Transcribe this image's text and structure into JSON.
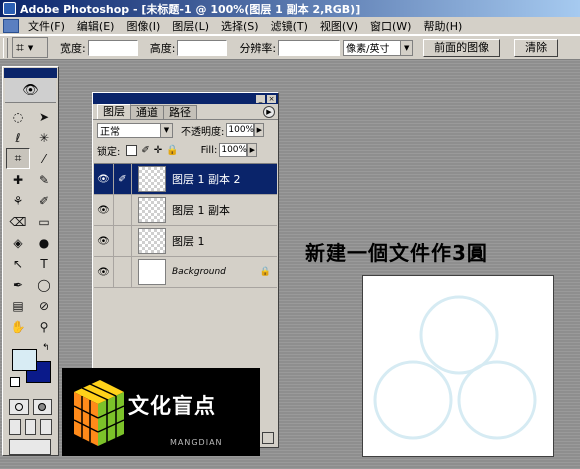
{
  "titlebar": {
    "title": "Adobe Photoshop - [未标题-1 @ 100%(图层 1 副本 2,RGB)]"
  },
  "menubar": {
    "items": [
      "文件(F)",
      "编辑(E)",
      "图像(I)",
      "图层(L)",
      "选择(S)",
      "滤镜(T)",
      "视图(V)",
      "窗口(W)",
      "帮助(H)"
    ]
  },
  "options": {
    "width_label": "宽度:",
    "width_value": "",
    "height_label": "高度:",
    "height_value": "",
    "resolution_label": "分辨率:",
    "resolution_value": "",
    "resolution_unit": "像素/英寸",
    "front_image_button": "前面的图像",
    "clear_button": "清除"
  },
  "toolbox": {
    "tools": [
      {
        "glyph": "◌",
        "name": "marquee-tool-icon"
      },
      {
        "glyph": "➤",
        "name": "move-tool-icon"
      },
      {
        "glyph": "ℓ",
        "name": "lasso-tool-icon"
      },
      {
        "glyph": "✳",
        "name": "magic-wand-tool-icon"
      },
      {
        "glyph": "⌗",
        "name": "crop-tool-icon"
      },
      {
        "glyph": "⁄",
        "name": "slice-tool-icon"
      },
      {
        "glyph": "✚",
        "name": "healing-brush-tool-icon"
      },
      {
        "glyph": "✎",
        "name": "brush-tool-icon"
      },
      {
        "glyph": "⚘",
        "name": "clone-stamp-tool-icon"
      },
      {
        "glyph": "✐",
        "name": "history-brush-tool-icon"
      },
      {
        "glyph": "⌫",
        "name": "eraser-tool-icon"
      },
      {
        "glyph": "▭",
        "name": "gradient-tool-icon"
      },
      {
        "glyph": "◈",
        "name": "blur-tool-icon"
      },
      {
        "glyph": "●",
        "name": "dodge-tool-icon"
      },
      {
        "glyph": "↖",
        "name": "path-selection-tool-icon"
      },
      {
        "glyph": "T",
        "name": "type-tool-icon"
      },
      {
        "glyph": "✒",
        "name": "pen-tool-icon"
      },
      {
        "glyph": "◯",
        "name": "shape-tool-icon"
      },
      {
        "glyph": "▤",
        "name": "notes-tool-icon"
      },
      {
        "glyph": "⊘",
        "name": "eyedropper-tool-icon"
      },
      {
        "glyph": "✋",
        "name": "hand-tool-icon"
      },
      {
        "glyph": "⚲",
        "name": "zoom-tool-icon"
      }
    ],
    "foreground_color": "#d8ecf4",
    "background_color": "#0a1a8a"
  },
  "layers": {
    "tabs": [
      "图层",
      "通道",
      "路径"
    ],
    "blend_mode": "正常",
    "opacity_label": "不透明度:",
    "opacity_value": "100%",
    "lock_label": "锁定:",
    "fill_label": "Fill:",
    "fill_value": "100%",
    "items": [
      {
        "name": "图层 1 副本 2",
        "selected": true,
        "italic": false,
        "locked": false
      },
      {
        "name": "图层 1 副本",
        "selected": false,
        "italic": false,
        "locked": false
      },
      {
        "name": "图层 1",
        "selected": false,
        "italic": false,
        "locked": false
      },
      {
        "name": "Background",
        "selected": false,
        "italic": true,
        "locked": true
      }
    ]
  },
  "caption": "新建一個文件作3圓",
  "logo": {
    "text": "文化盲点",
    "sub": "MANGDIAN"
  },
  "colors": {
    "circle_stroke": "#d6ebf3",
    "accent": "#0a246a"
  }
}
